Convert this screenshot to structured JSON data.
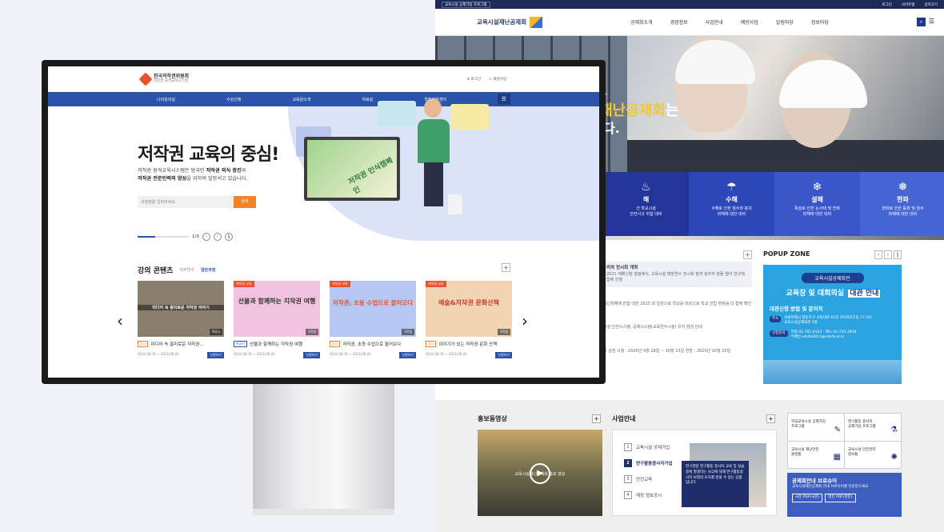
{
  "bg_site": {
    "topbar": {
      "select": "교육시설 공제가입 프로그램",
      "links": [
        "로그인",
        "사이트맵",
        "글자크기"
      ]
    },
    "logo": "교육시설재난공제회",
    "nav": [
      "공제회소개",
      "경영정보",
      "사업안내",
      "예방사업",
      "알림마당",
      "정보마당"
    ],
    "hero": {
      "line1": "을",
      "line2_a": "재난공제회",
      "line2_b": "는",
      "line3": "다."
    },
    "disasters": [
      {
        "title": "해",
        "desc": "선 학교시설\n안전사고 위험 대비",
        "icon": "fire-icon",
        "color": "#23349a"
      },
      {
        "title": "수해",
        "desc": "수해로 인한 침수와 붕괴\n피해에 대한 대비",
        "icon": "rain-icon",
        "color": "#2e47b8"
      },
      {
        "title": "설해",
        "desc": "폭설로 인한 눈사태 및 한파\n피해에 대한 대비",
        "icon": "snow-icon",
        "color": "#3a56c8"
      },
      {
        "title": "한파",
        "desc": "한파로 인한 동파 및 침수\n피해에 대한 대비",
        "icon": "cold-icon",
        "color": "#4565d4"
      }
    ],
    "notices": [
      {
        "title": "리의 전시회 개최",
        "body": "2021 재해신청 알림에서, 교육시설 예방연수 전시회 참여 실무자 분들 열어 연구에 함께 진행"
      },
      {
        "title": "",
        "body": "재난피해에 한함 대한 2015 외 일원으로 학교를 대상으로 학교 건립 변화를 다 함께 확인"
      },
      {
        "title": "",
        "body": "시설 안전시스템, 공제시스템(교육연수시설) 유지 점검 안내"
      },
      {
        "title": "",
        "body": "공 상점 시행 : 2020년 9월 28일 ~ 10월 13일 연장 : 2020년 10월 20일"
      }
    ],
    "popup": {
      "title": "POPUP ZONE",
      "label": "교육시설공제회관",
      "headline_a": "교육장 및 대회의실",
      "headline_b": "대관 안내",
      "sub": "대관신청 방법 및 문의처",
      "addr_k": "주소",
      "addr": "서울특별시 영등포구 국회대로 62길 25(여의도동 17-10)\n교육시설공제회관 3층",
      "phone_k": "신청문의",
      "phone": "전화 02-781-0123 · 팩스 02-720-3918\n이메일 edufa2011@edufa.or.kr"
    },
    "video": {
      "title": "홍보동영상",
      "caption": "교육시설재난공제회 홍보 영상"
    },
    "biz": {
      "title": "사업안내",
      "items": [
        "교육시설 공제가입",
        "연구활동종사자가입",
        "안전교육",
        "재정 정보공시"
      ],
      "box": "연구관련 연구활동 종사자 교육 및 실습 중에 발생하는 사고에 대해 연구활동종사자 보험의 보호를 받을 수 있는 상품입니다."
    },
    "quick": [
      {
        "label": "학교교육시설 공제가입\n프로그램",
        "icon": "pen-icon"
      },
      {
        "label": "연구활동 종사자\n공제가입 프로그램",
        "icon": "flask-icon"
      },
      {
        "label": "교육시설 재난안전\n플랫폼",
        "icon": "building-icon"
      },
      {
        "label": "교육시설 안전관리\n정보통",
        "icon": "atom-icon"
      }
    ],
    "promo": {
      "title": "공제회안내 브로슈어",
      "body": "교육시설재난공제회 안내 브로슈어를 다운받으세요.",
      "btn1": "국문 PDF(국문)",
      "btn2": "영문 PDF(영문)"
    }
  },
  "screen": {
    "logo_main": "한국저작권위원회",
    "logo_sub": "저작권 원격교육시스템",
    "util": [
      "로그인",
      "회원가입"
    ],
    "nav": [
      "나의강의실",
      "수강신청",
      "교육원소개",
      "자료실",
      "학습지원센터"
    ],
    "hero": {
      "title": "저작권 교육의 중심!",
      "desc1": "저작권 원격교육시스템은 범국민 ",
      "desc1b": "저작권 의식 증진",
      "desc1c": "과",
      "desc2b": "저작권 전문인력의 양성",
      "desc2c": "을 위하여 앞장서고 있습니다.",
      "search_placeholder": "과정명을 입력하세요.",
      "search_btn": "검색",
      "page": "1/3",
      "monitor_text": "저작권 인식캠페인"
    },
    "section": {
      "title": "강의 콘텐츠",
      "tab1": "직무연수",
      "tab2": "일반과정"
    },
    "cards": [
      {
        "tag": "",
        "thumb": "미디어 속 흥미로운 저작권 이야기",
        "count": "6차시",
        "badge": "공사",
        "title": "미디어 속 흥미로운 저작권...",
        "date": "2022.08.16 ~ 2022.08.26",
        "apply": "신청하기",
        "bg": "#8a7e6c"
      },
      {
        "tag": "저작권 교육",
        "thumb": "선율과 함께하는 지작권 여행",
        "count": "1학점",
        "badge": "비공사",
        "title": "선율과 함께하는 저작권 여행",
        "date": "2022.08.16 ~ 2022.08.26",
        "apply": "신청하기",
        "bg": "#f2c3e0"
      },
      {
        "tag": "저작권 교육",
        "thumb": "저작권, 초등 수업으로 들어오다",
        "count": "1학점",
        "badge": "공사",
        "title": "저작권, 초등 수업으로 들어오다",
        "date": "2022.08.16 ~ 2022.08.26",
        "apply": "신청하기",
        "bg": "#b6c8f2"
      },
      {
        "tag": "저작권 교육",
        "thumb": "예술&저작권 문화산책",
        "count": "1학점",
        "badge": "공사",
        "title": "이야기가 있는 저작권 문화 산책",
        "date": "2022.08.16 ~ 2022.08.26",
        "apply": "신청하기",
        "bg": "#f0d4b4"
      }
    ]
  }
}
